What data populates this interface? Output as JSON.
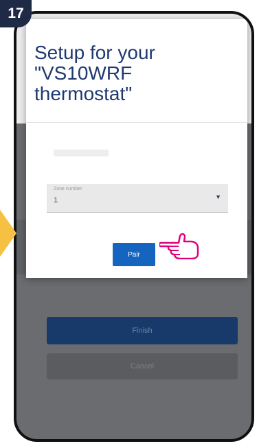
{
  "step": {
    "number": "17"
  },
  "dialog": {
    "title": "Setup for your \"VS10WRF thermostat\"",
    "select": {
      "label": "Zone number",
      "value": "1"
    },
    "pair_label": "Pair"
  },
  "background": {
    "finish_label": "Finish",
    "cancel_label": "Cancel"
  },
  "colors": {
    "badge": "#1f2b46",
    "arrow": "#f6c142",
    "title": "#1f3970",
    "primary": "#1565c0",
    "hand": "#e0007a"
  },
  "icons": {
    "caret": "caret-down-icon",
    "hand": "pointing-hand-icon"
  }
}
